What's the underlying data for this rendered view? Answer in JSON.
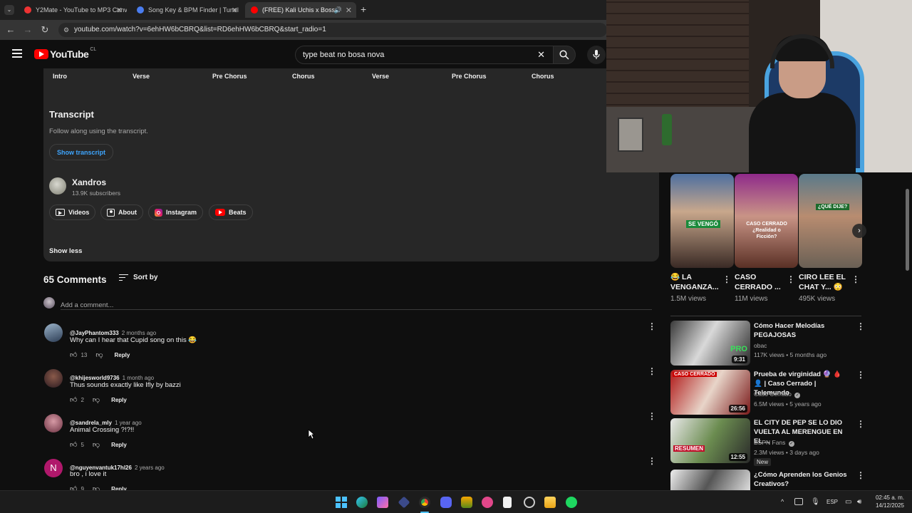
{
  "browser": {
    "tabs": [
      {
        "title": "Y2Mate - YouTube to MP3 Conv",
        "active": false
      },
      {
        "title": "Song Key & BPM Finder | Tunel",
        "active": false
      },
      {
        "title": "(FREE) Kali Uchis x Bossa No",
        "active": true
      }
    ],
    "new_tab": "+",
    "url": "youtube.com/watch?v=6ehHW6bCBRQ&list=RD6ehHW6bCBRQ&start_radio=1"
  },
  "youtube": {
    "logo": "YouTube",
    "country": "CL",
    "search_value": "type beat no bosa nova"
  },
  "chapters": [
    "Intro",
    "Verse",
    "Pre Chorus",
    "Chorus",
    "Verse",
    "Pre Chorus",
    "Chorus"
  ],
  "transcript": {
    "heading": "Transcript",
    "subtitle": "Follow along using the transcript.",
    "button": "Show transcript"
  },
  "channel": {
    "name": "Xandros",
    "subscribers": "13.9K subscribers",
    "links": [
      "Videos",
      "About",
      "Instagram",
      "Beats"
    ],
    "show_less": "Show less"
  },
  "comments_section": {
    "count_label": "65 Comments",
    "sort_label": "Sort by",
    "add_placeholder": "Add a comment...",
    "comments": [
      {
        "handle": "@JayPhantom333",
        "time": "2 months ago",
        "text": "Why can I hear that Cupid song on this 😂",
        "likes": "13",
        "reply": "Reply"
      },
      {
        "handle": "@khijesworld9736",
        "time": "1 month ago",
        "text": "Thus sounds exactly like Ifly by bazzi",
        "likes": "2",
        "reply": "Reply"
      },
      {
        "handle": "@sandrela_mly",
        "time": "1 year ago",
        "text": "Animal Crossing ?!?!!",
        "likes": "5",
        "reply": "Reply"
      },
      {
        "handle": "@nguyenvantuk17hl26",
        "time": "2 years ago",
        "text": "bro , i love it",
        "likes": "9",
        "reply": "Reply",
        "avatar_letter": "N"
      }
    ]
  },
  "shorts": [
    {
      "title_line1": "😂 LA",
      "title_line2": "VENGANZA...",
      "views": "1.5M views",
      "overlay": "SE VENGÓ"
    },
    {
      "title_line1": "CASO",
      "title_line2": "CERRADO ...",
      "views": "11M views",
      "overlay": "CASO CERRADO ¿Realidad o Ficción?"
    },
    {
      "title_line1": "CIRO LEE EL",
      "title_line2": "CHAT Y... 😳",
      "views": "495K views",
      "overlay": "¿QUÉ DIJE?"
    }
  ],
  "recommended": [
    {
      "title": "Cómo Hacer Melodías PEGAJOSAS",
      "channel": "obac",
      "meta": "117K views • 5 months ago",
      "duration": "9:31",
      "thumb_text": "PRO"
    },
    {
      "title": "Prueba de virginidad 🔮 🩸 👤 | Caso Cerrado | Telemundo",
      "channel": "Caso Cerrado",
      "meta": "6.5M views • 5 years ago",
      "duration": "26:56",
      "thumb_text": "CASO CERRADO"
    },
    {
      "title": "EL CITY DE PEP SE LO DIO VUELTA AL MERENGUE EN EL ...",
      "channel": "ESPN Fans",
      "meta": "2.3M views • 3 days ago",
      "duration": "12:55",
      "badge": "New",
      "thumb_text": "RESUMEN"
    },
    {
      "title": "¿Cómo Aprenden los Genios Creativos?",
      "channel": "",
      "meta": "",
      "duration": ""
    }
  ],
  "taskbar": {
    "language": "ESP",
    "time": "02:45 a. m.",
    "date": "14/12/2025"
  },
  "colors": {
    "youtube_red": "#ff0000",
    "link_blue": "#3ea6ff",
    "background": "#0f0f0f",
    "panel": "#272727"
  }
}
